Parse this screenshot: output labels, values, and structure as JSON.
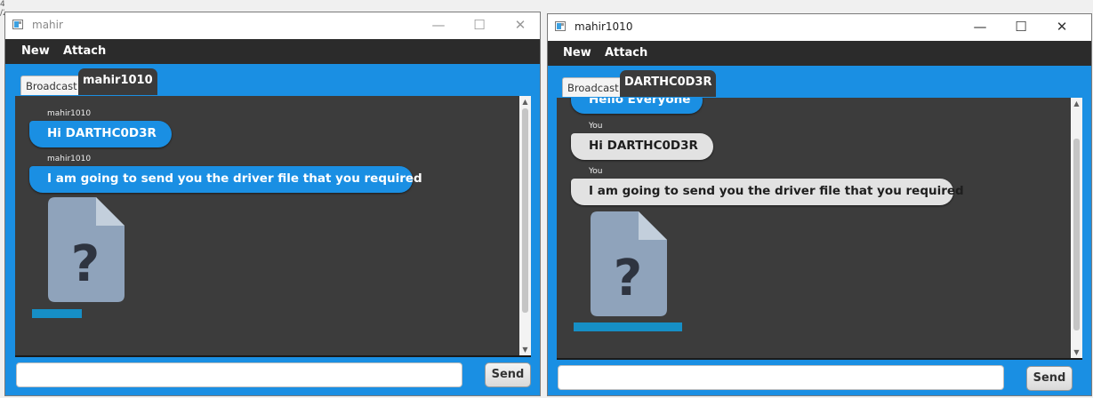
{
  "left_window": {
    "title": "mahir",
    "window_controls": {
      "minimize": "—",
      "maximize": "☐",
      "close": "✕"
    },
    "menu": [
      "New",
      "Attach"
    ],
    "tabs": [
      {
        "label": "Broadcast",
        "active": false
      },
      {
        "label": "mahir1010",
        "active": true
      }
    ],
    "messages": [
      {
        "sender": "mahir1010",
        "text": "Hi DARTHC0D3R",
        "style": "incoming"
      },
      {
        "sender": "mahir1010",
        "text": "I am going to send you the driver file that you required",
        "style": "incoming"
      }
    ],
    "attachment": {
      "icon": "unknown-file-icon",
      "glyph": "?"
    },
    "input_value": "",
    "send_label": "Send"
  },
  "right_window": {
    "title": "mahir1010",
    "window_controls": {
      "minimize": "—",
      "maximize": "☐",
      "close": "✕"
    },
    "menu": [
      "New",
      "Attach"
    ],
    "tabs": [
      {
        "label": "Broadcast",
        "active": false
      },
      {
        "label": "DARTHC0D3R",
        "active": true
      }
    ],
    "partial_message": {
      "text": "Hello Everyone",
      "style": "incoming"
    },
    "messages": [
      {
        "sender": "You",
        "text": "Hi DARTHC0D3R",
        "style": "outgoing"
      },
      {
        "sender": "You",
        "text": "I am going to send you the driver file that you required",
        "style": "outgoing"
      }
    ],
    "attachment": {
      "icon": "unknown-file-icon",
      "glyph": "?"
    },
    "input_value": "",
    "send_label": "Send"
  },
  "colors": {
    "accent_blue": "#1a8fe3",
    "chat_background": "#3c3c3c",
    "menubar": "#2b2b2b",
    "outgoing_bubble": "#e2e2e2",
    "file_icon": "#8fa3bb",
    "progress": "#168fc6"
  }
}
